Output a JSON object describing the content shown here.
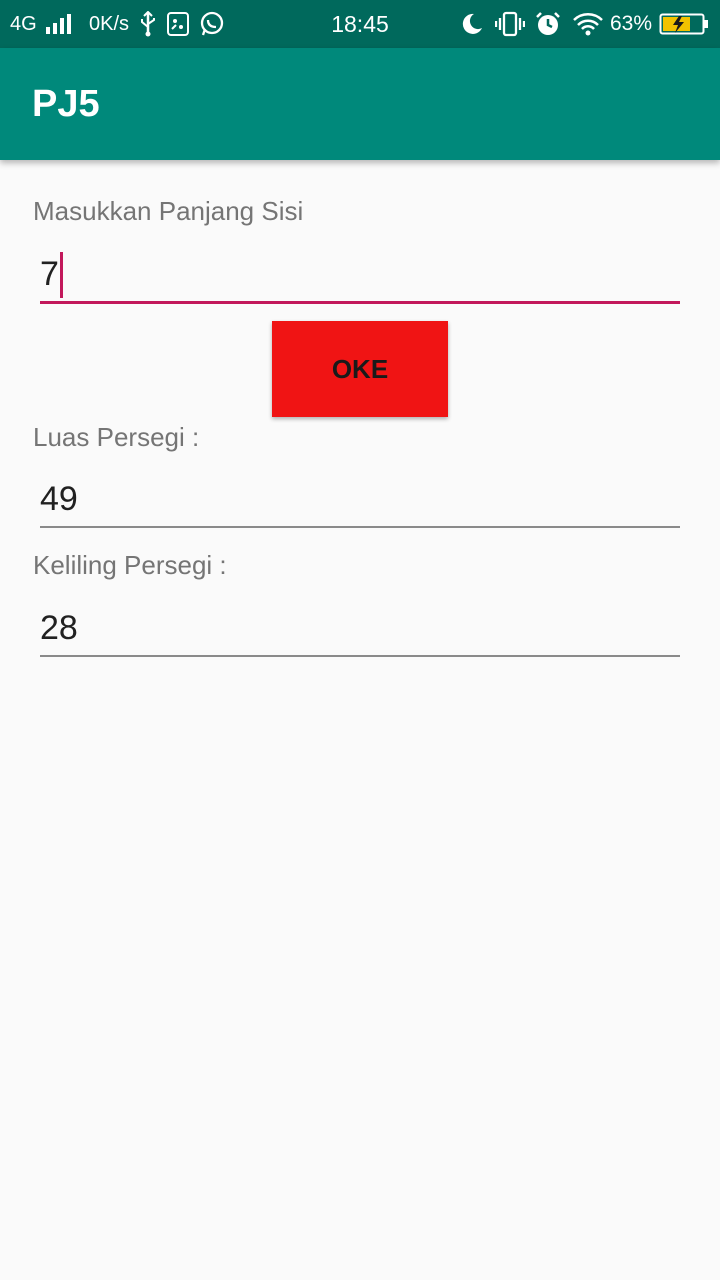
{
  "status_bar": {
    "network": "4G",
    "speed": "0K/s",
    "time": "18:45",
    "battery_percent": "63%",
    "icons": [
      "signal-icon",
      "usb-icon",
      "debug-icon",
      "whatsapp-icon",
      "moon-icon",
      "vibrate-icon",
      "alarm-icon",
      "wifi-icon",
      "battery-icon"
    ]
  },
  "app_bar": {
    "title": "PJ5"
  },
  "form": {
    "side_label": "Masukkan Panjang Sisi",
    "side_value": "7",
    "oke_label": "OKE",
    "area_label": "Luas Persegi :",
    "area_value": "49",
    "perimeter_label": "Keliling Persegi :",
    "perimeter_value": "28"
  },
  "colors": {
    "status_bar": "#00695c",
    "app_bar": "#00897b",
    "accent": "#c2185b",
    "button": "#f01414",
    "background": "#fafafa"
  }
}
